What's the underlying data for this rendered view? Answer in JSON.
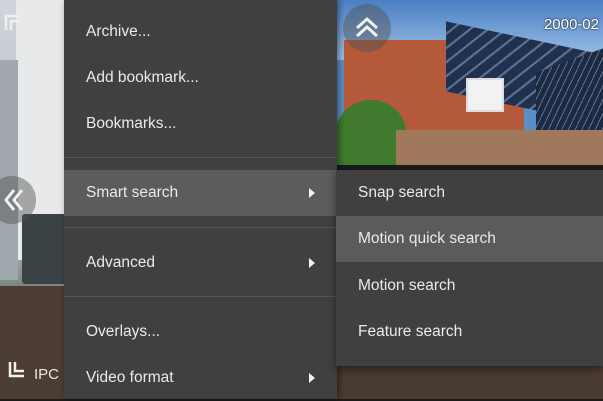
{
  "camera_tiles": {
    "top_right_timestamp": "2000-02",
    "bottom_left_label": "IPC"
  },
  "context_menu": {
    "items": [
      {
        "label": "Archive...",
        "has_submenu": false
      },
      {
        "label": "Add bookmark...",
        "has_submenu": false
      },
      {
        "label": "Bookmarks...",
        "has_submenu": false
      },
      {
        "label": "Smart search",
        "has_submenu": true,
        "active": true
      },
      {
        "label": "Advanced",
        "has_submenu": true
      },
      {
        "label": "Overlays...",
        "has_submenu": false
      },
      {
        "label": "Video format",
        "has_submenu": true
      }
    ]
  },
  "submenu": {
    "items": [
      {
        "label": "Snap search"
      },
      {
        "label": "Motion quick search",
        "hover": true
      },
      {
        "label": "Motion search"
      },
      {
        "label": "Feature search"
      }
    ]
  },
  "icons": {
    "chevron_up": "chevron-up-icon",
    "chevron_left": "chevron-left-icon",
    "corner_top_left": "frame-corner-top-left-icon",
    "corner_bottom_left": "frame-corner-bottom-left-icon",
    "submenu_arrow": "submenu-arrow-icon"
  },
  "colors": {
    "menu_bg": "#404040",
    "menu_active_bg": "#5c5c5c",
    "submenu_hover_bg": "#5b5b5b",
    "menu_text": "#eaeaea"
  }
}
